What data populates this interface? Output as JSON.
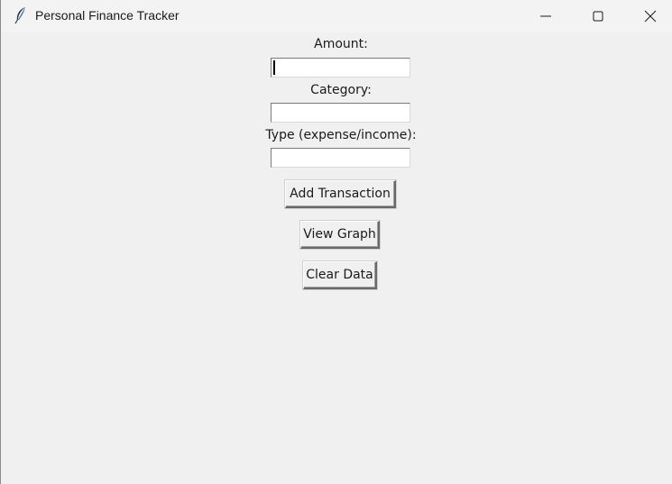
{
  "window": {
    "title": "Personal Finance Tracker",
    "icon": "feather-icon"
  },
  "form": {
    "amount_label": "Amount:",
    "amount_value": "",
    "category_label": "Category:",
    "category_value": "",
    "type_label": "Type (expense/income):",
    "type_value": ""
  },
  "buttons": {
    "add_transaction": "Add Transaction",
    "view_graph": "View Graph",
    "clear_data": "Clear Data"
  }
}
